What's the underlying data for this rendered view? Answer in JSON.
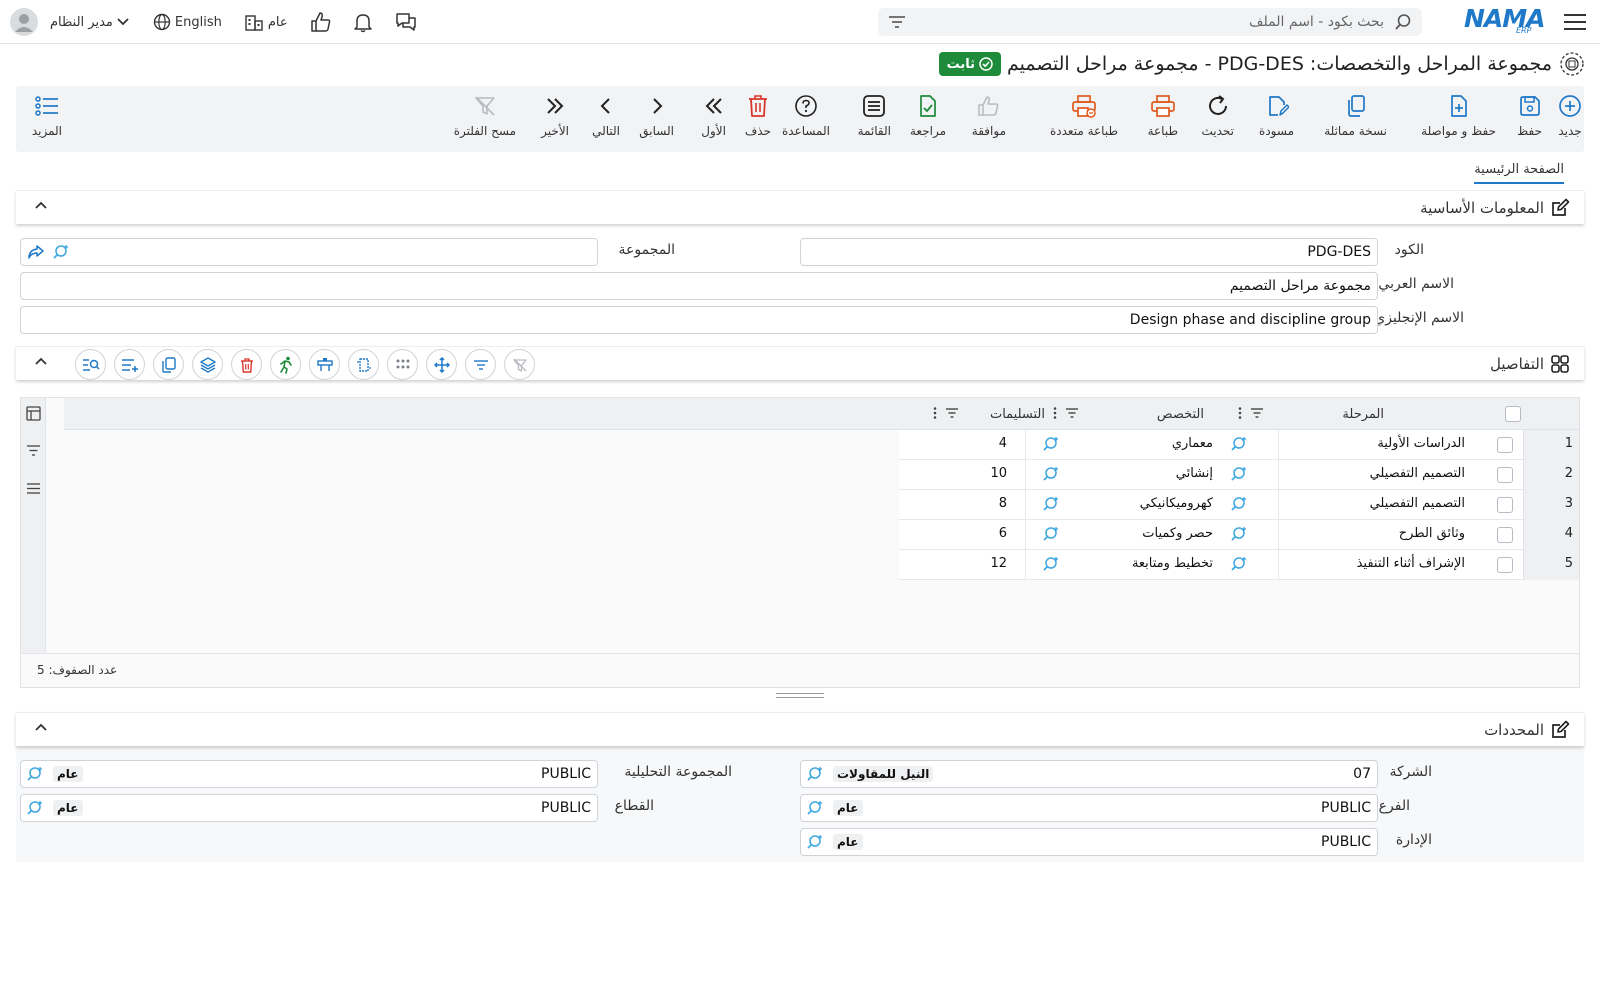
{
  "topbar": {
    "logo": "NAMA",
    "logo_sub": "ERP",
    "search_placeholder": "بحث بكود - اسم الملف",
    "user_name": "مدير النظام",
    "language": "English",
    "branch": "عام"
  },
  "title": {
    "text": "مجموعة المراحل والتخصصات: PDG-DES - مجموعة مراحل التصميم",
    "status": "ثابت",
    "status_color": "#1d8b3a"
  },
  "toolbar": {
    "new": "جديد",
    "save": "حفظ",
    "save_continue": "حفظ و مواصلة",
    "duplicate": "نسخة مماثلة",
    "draft": "مسودة",
    "refresh": "تحديث",
    "print": "طباعة",
    "multi_print": "طباعة متعددة",
    "approve": "موافقة",
    "review": "مراجعة",
    "list": "القائمة",
    "help": "المساعدة",
    "delete": "حذف",
    "first": "الأول",
    "previous": "السابق",
    "next": "التالي",
    "last": "الأخير",
    "clear_filter": "مسح الفلترة",
    "more": "المزيد"
  },
  "tabs": {
    "main": "الصفحة الرئيسية"
  },
  "basic_info": {
    "title": "المعلومات الأساسية",
    "code_label": "الكود",
    "code_value": "PDG-DES",
    "group_label": "المجموعة",
    "group_value": "",
    "arabic_name_label": "الاسم العربي",
    "arabic_name_value": "مجموعة مراحل التصميم",
    "english_name_label": "الاسم الإنجليزي",
    "english_name_value": "Design phase and discipline group"
  },
  "details": {
    "title": "التفاصيل",
    "columns": {
      "phase": "المرحلة",
      "discipline": "التخصص",
      "deliverables": "التسليمات"
    },
    "rows": [
      {
        "num": "1",
        "phase": "الدراسات الأولية",
        "discipline": "معماري",
        "deliverables": "4"
      },
      {
        "num": "2",
        "phase": "التصميم التفصيلي",
        "discipline": "إنشائي",
        "deliverables": "10"
      },
      {
        "num": "3",
        "phase": "التصميم التفصيلي",
        "discipline": "كهروميكانيكي",
        "deliverables": "8"
      },
      {
        "num": "4",
        "phase": "وثائق الطرح",
        "discipline": "حصر وكميات",
        "deliverables": "6"
      },
      {
        "num": "5",
        "phase": "الإشراف أثناء التنفيذ",
        "discipline": "تخطيط ومتابعة",
        "deliverables": "12"
      }
    ],
    "row_count": "عدد الصفوف: 5"
  },
  "determinants": {
    "title": "المحددات",
    "company_label": "الشركة",
    "company_value": "07",
    "company_tag": "النيل للمقاولات",
    "branch_label": "الفرع",
    "branch_value": "PUBLIC",
    "branch_tag": "عام",
    "department_label": "الإدارة",
    "department_value": "PUBLIC",
    "department_tag": "عام",
    "analytic_group_label": "المجموعة التحليلية",
    "analytic_group_value": "PUBLIC",
    "analytic_group_tag": "عام",
    "sector_label": "القطاع",
    "sector_value": "PUBLIC",
    "sector_tag": "عام"
  }
}
